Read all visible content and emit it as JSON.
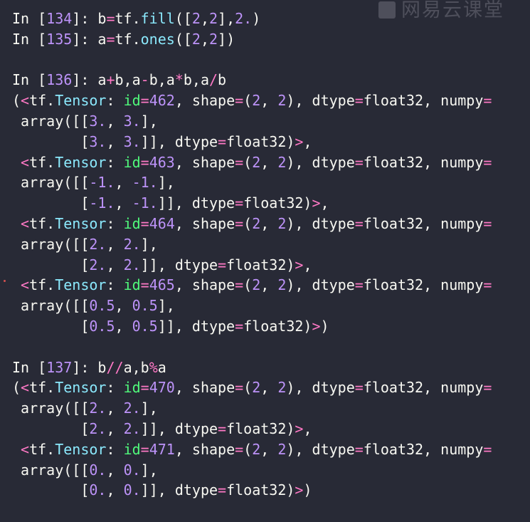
{
  "watermark": "网易云课堂",
  "colors": {
    "background": "#282a36",
    "default_text": "#f8f8f2",
    "number": "#bd93f9",
    "operator": "#ff79c6",
    "builtin": "#8be9fd",
    "keyword": "#50fa7b"
  },
  "lines": [
    [
      {
        "t": "In [",
        "c": "w"
      },
      {
        "t": "134",
        "c": "p"
      },
      {
        "t": "]: b",
        "c": "w"
      },
      {
        "t": "=",
        "c": "o"
      },
      {
        "t": "tf.",
        "c": "w"
      },
      {
        "t": "fill",
        "c": "b"
      },
      {
        "t": "([",
        "c": "w"
      },
      {
        "t": "2",
        "c": "p"
      },
      {
        "t": ",",
        "c": "w"
      },
      {
        "t": "2",
        "c": "p"
      },
      {
        "t": "],",
        "c": "w"
      },
      {
        "t": "2.",
        "c": "p"
      },
      {
        "t": ")",
        "c": "w"
      }
    ],
    [
      {
        "t": "In [",
        "c": "w"
      },
      {
        "t": "135",
        "c": "p"
      },
      {
        "t": "]: a",
        "c": "w"
      },
      {
        "t": "=",
        "c": "o"
      },
      {
        "t": "tf.",
        "c": "w"
      },
      {
        "t": "ones",
        "c": "b"
      },
      {
        "t": "([",
        "c": "w"
      },
      {
        "t": "2",
        "c": "p"
      },
      {
        "t": ",",
        "c": "w"
      },
      {
        "t": "2",
        "c": "p"
      },
      {
        "t": "])",
        "c": "w"
      }
    ],
    [],
    [
      {
        "t": "In [",
        "c": "w"
      },
      {
        "t": "136",
        "c": "p"
      },
      {
        "t": "]: a",
        "c": "w"
      },
      {
        "t": "+",
        "c": "o"
      },
      {
        "t": "b,a",
        "c": "w"
      },
      {
        "t": "-",
        "c": "o"
      },
      {
        "t": "b,a",
        "c": "w"
      },
      {
        "t": "*",
        "c": "o"
      },
      {
        "t": "b,a",
        "c": "w"
      },
      {
        "t": "/",
        "c": "o"
      },
      {
        "t": "b",
        "c": "w"
      }
    ],
    [
      {
        "t": "(",
        "c": "w"
      },
      {
        "t": "<",
        "c": "o"
      },
      {
        "t": "tf.",
        "c": "w"
      },
      {
        "t": "Tensor",
        "c": "b"
      },
      {
        "t": ": ",
        "c": "w"
      },
      {
        "t": "id",
        "c": "g"
      },
      {
        "t": "=",
        "c": "o"
      },
      {
        "t": "462",
        "c": "p"
      },
      {
        "t": ", shape",
        "c": "w"
      },
      {
        "t": "=",
        "c": "o"
      },
      {
        "t": "(",
        "c": "w"
      },
      {
        "t": "2",
        "c": "p"
      },
      {
        "t": ", ",
        "c": "w"
      },
      {
        "t": "2",
        "c": "p"
      },
      {
        "t": "), dtype",
        "c": "w"
      },
      {
        "t": "=",
        "c": "o"
      },
      {
        "t": "float32, numpy",
        "c": "w"
      },
      {
        "t": "=",
        "c": "o"
      }
    ],
    [
      {
        "t": " array([[",
        "c": "w"
      },
      {
        "t": "3.",
        "c": "p"
      },
      {
        "t": ", ",
        "c": "w"
      },
      {
        "t": "3.",
        "c": "p"
      },
      {
        "t": "],",
        "c": "w"
      }
    ],
    [
      {
        "t": "        [",
        "c": "w"
      },
      {
        "t": "3.",
        "c": "p"
      },
      {
        "t": ", ",
        "c": "w"
      },
      {
        "t": "3.",
        "c": "p"
      },
      {
        "t": "]], dtype",
        "c": "w"
      },
      {
        "t": "=",
        "c": "o"
      },
      {
        "t": "float32)",
        "c": "w"
      },
      {
        "t": ">",
        "c": "o"
      },
      {
        "t": ",",
        "c": "w"
      }
    ],
    [
      {
        "t": " ",
        "c": "w"
      },
      {
        "t": "<",
        "c": "o"
      },
      {
        "t": "tf.",
        "c": "w"
      },
      {
        "t": "Tensor",
        "c": "b"
      },
      {
        "t": ": ",
        "c": "w"
      },
      {
        "t": "id",
        "c": "g"
      },
      {
        "t": "=",
        "c": "o"
      },
      {
        "t": "463",
        "c": "p"
      },
      {
        "t": ", shape",
        "c": "w"
      },
      {
        "t": "=",
        "c": "o"
      },
      {
        "t": "(",
        "c": "w"
      },
      {
        "t": "2",
        "c": "p"
      },
      {
        "t": ", ",
        "c": "w"
      },
      {
        "t": "2",
        "c": "p"
      },
      {
        "t": "), dtype",
        "c": "w"
      },
      {
        "t": "=",
        "c": "o"
      },
      {
        "t": "float32, numpy",
        "c": "w"
      },
      {
        "t": "=",
        "c": "o"
      }
    ],
    [
      {
        "t": " array([[",
        "c": "w"
      },
      {
        "t": "-1.",
        "c": "p"
      },
      {
        "t": ", ",
        "c": "w"
      },
      {
        "t": "-1.",
        "c": "p"
      },
      {
        "t": "],",
        "c": "w"
      }
    ],
    [
      {
        "t": "        [",
        "c": "w"
      },
      {
        "t": "-1.",
        "c": "p"
      },
      {
        "t": ", ",
        "c": "w"
      },
      {
        "t": "-1.",
        "c": "p"
      },
      {
        "t": "]], dtype",
        "c": "w"
      },
      {
        "t": "=",
        "c": "o"
      },
      {
        "t": "float32)",
        "c": "w"
      },
      {
        "t": ">",
        "c": "o"
      },
      {
        "t": ",",
        "c": "w"
      }
    ],
    [
      {
        "t": " ",
        "c": "w"
      },
      {
        "t": "<",
        "c": "o"
      },
      {
        "t": "tf.",
        "c": "w"
      },
      {
        "t": "Tensor",
        "c": "b"
      },
      {
        "t": ": ",
        "c": "w"
      },
      {
        "t": "id",
        "c": "g"
      },
      {
        "t": "=",
        "c": "o"
      },
      {
        "t": "464",
        "c": "p"
      },
      {
        "t": ", shape",
        "c": "w"
      },
      {
        "t": "=",
        "c": "o"
      },
      {
        "t": "(",
        "c": "w"
      },
      {
        "t": "2",
        "c": "p"
      },
      {
        "t": ", ",
        "c": "w"
      },
      {
        "t": "2",
        "c": "p"
      },
      {
        "t": "), dtype",
        "c": "w"
      },
      {
        "t": "=",
        "c": "o"
      },
      {
        "t": "float32, numpy",
        "c": "w"
      },
      {
        "t": "=",
        "c": "o"
      }
    ],
    [
      {
        "t": " array([[",
        "c": "w"
      },
      {
        "t": "2.",
        "c": "p"
      },
      {
        "t": ", ",
        "c": "w"
      },
      {
        "t": "2.",
        "c": "p"
      },
      {
        "t": "],",
        "c": "w"
      }
    ],
    [
      {
        "t": "        [",
        "c": "w"
      },
      {
        "t": "2.",
        "c": "p"
      },
      {
        "t": ", ",
        "c": "w"
      },
      {
        "t": "2.",
        "c": "p"
      },
      {
        "t": "]], dtype",
        "c": "w"
      },
      {
        "t": "=",
        "c": "o"
      },
      {
        "t": "float32)",
        "c": "w"
      },
      {
        "t": ">",
        "c": "o"
      },
      {
        "t": ",",
        "c": "w"
      }
    ],
    [
      {
        "t": " ",
        "c": "w"
      },
      {
        "t": "<",
        "c": "o"
      },
      {
        "t": "tf.",
        "c": "w"
      },
      {
        "t": "Tensor",
        "c": "b"
      },
      {
        "t": ": ",
        "c": "w"
      },
      {
        "t": "id",
        "c": "g"
      },
      {
        "t": "=",
        "c": "o"
      },
      {
        "t": "465",
        "c": "p"
      },
      {
        "t": ", shape",
        "c": "w"
      },
      {
        "t": "=",
        "c": "o"
      },
      {
        "t": "(",
        "c": "w"
      },
      {
        "t": "2",
        "c": "p"
      },
      {
        "t": ", ",
        "c": "w"
      },
      {
        "t": "2",
        "c": "p"
      },
      {
        "t": "), dtype",
        "c": "w"
      },
      {
        "t": "=",
        "c": "o"
      },
      {
        "t": "float32, numpy",
        "c": "w"
      },
      {
        "t": "=",
        "c": "o"
      }
    ],
    [
      {
        "t": " array([[",
        "c": "w"
      },
      {
        "t": "0.5",
        "c": "p"
      },
      {
        "t": ", ",
        "c": "w"
      },
      {
        "t": "0.5",
        "c": "p"
      },
      {
        "t": "],",
        "c": "w"
      }
    ],
    [
      {
        "t": "        [",
        "c": "w"
      },
      {
        "t": "0.5",
        "c": "p"
      },
      {
        "t": ", ",
        "c": "w"
      },
      {
        "t": "0.5",
        "c": "p"
      },
      {
        "t": "]], dtype",
        "c": "w"
      },
      {
        "t": "=",
        "c": "o"
      },
      {
        "t": "float32)",
        "c": "w"
      },
      {
        "t": ">",
        "c": "o"
      },
      {
        "t": ")",
        "c": "w"
      }
    ],
    [],
    [
      {
        "t": "In [",
        "c": "w"
      },
      {
        "t": "137",
        "c": "p"
      },
      {
        "t": "]: b",
        "c": "w"
      },
      {
        "t": "//",
        "c": "o"
      },
      {
        "t": "a,b",
        "c": "w"
      },
      {
        "t": "%",
        "c": "o"
      },
      {
        "t": "a",
        "c": "w"
      }
    ],
    [
      {
        "t": "(",
        "c": "w"
      },
      {
        "t": "<",
        "c": "o"
      },
      {
        "t": "tf.",
        "c": "w"
      },
      {
        "t": "Tensor",
        "c": "b"
      },
      {
        "t": ": ",
        "c": "w"
      },
      {
        "t": "id",
        "c": "g"
      },
      {
        "t": "=",
        "c": "o"
      },
      {
        "t": "470",
        "c": "p"
      },
      {
        "t": ", shape",
        "c": "w"
      },
      {
        "t": "=",
        "c": "o"
      },
      {
        "t": "(",
        "c": "w"
      },
      {
        "t": "2",
        "c": "p"
      },
      {
        "t": ", ",
        "c": "w"
      },
      {
        "t": "2",
        "c": "p"
      },
      {
        "t": "), dtype",
        "c": "w"
      },
      {
        "t": "=",
        "c": "o"
      },
      {
        "t": "float32, numpy",
        "c": "w"
      },
      {
        "t": "=",
        "c": "o"
      }
    ],
    [
      {
        "t": " array([[",
        "c": "w"
      },
      {
        "t": "2.",
        "c": "p"
      },
      {
        "t": ", ",
        "c": "w"
      },
      {
        "t": "2.",
        "c": "p"
      },
      {
        "t": "],",
        "c": "w"
      }
    ],
    [
      {
        "t": "        [",
        "c": "w"
      },
      {
        "t": "2.",
        "c": "p"
      },
      {
        "t": ", ",
        "c": "w"
      },
      {
        "t": "2.",
        "c": "p"
      },
      {
        "t": "]], dtype",
        "c": "w"
      },
      {
        "t": "=",
        "c": "o"
      },
      {
        "t": "float32)",
        "c": "w"
      },
      {
        "t": ">",
        "c": "o"
      },
      {
        "t": ",",
        "c": "w"
      }
    ],
    [
      {
        "t": " ",
        "c": "w"
      },
      {
        "t": "<",
        "c": "o"
      },
      {
        "t": "tf.",
        "c": "w"
      },
      {
        "t": "Tensor",
        "c": "b"
      },
      {
        "t": ": ",
        "c": "w"
      },
      {
        "t": "id",
        "c": "g"
      },
      {
        "t": "=",
        "c": "o"
      },
      {
        "t": "471",
        "c": "p"
      },
      {
        "t": ", shape",
        "c": "w"
      },
      {
        "t": "=",
        "c": "o"
      },
      {
        "t": "(",
        "c": "w"
      },
      {
        "t": "2",
        "c": "p"
      },
      {
        "t": ", ",
        "c": "w"
      },
      {
        "t": "2",
        "c": "p"
      },
      {
        "t": "), dtype",
        "c": "w"
      },
      {
        "t": "=",
        "c": "o"
      },
      {
        "t": "float32, numpy",
        "c": "w"
      },
      {
        "t": "=",
        "c": "o"
      }
    ],
    [
      {
        "t": " array([[",
        "c": "w"
      },
      {
        "t": "0.",
        "c": "p"
      },
      {
        "t": ", ",
        "c": "w"
      },
      {
        "t": "0.",
        "c": "p"
      },
      {
        "t": "],",
        "c": "w"
      }
    ],
    [
      {
        "t": "        [",
        "c": "w"
      },
      {
        "t": "0.",
        "c": "p"
      },
      {
        "t": ", ",
        "c": "w"
      },
      {
        "t": "0.",
        "c": "p"
      },
      {
        "t": "]], dtype",
        "c": "w"
      },
      {
        "t": "=",
        "c": "o"
      },
      {
        "t": "float32)",
        "c": "w"
      },
      {
        "t": ">",
        "c": "o"
      },
      {
        "t": ")",
        "c": "w"
      }
    ]
  ]
}
